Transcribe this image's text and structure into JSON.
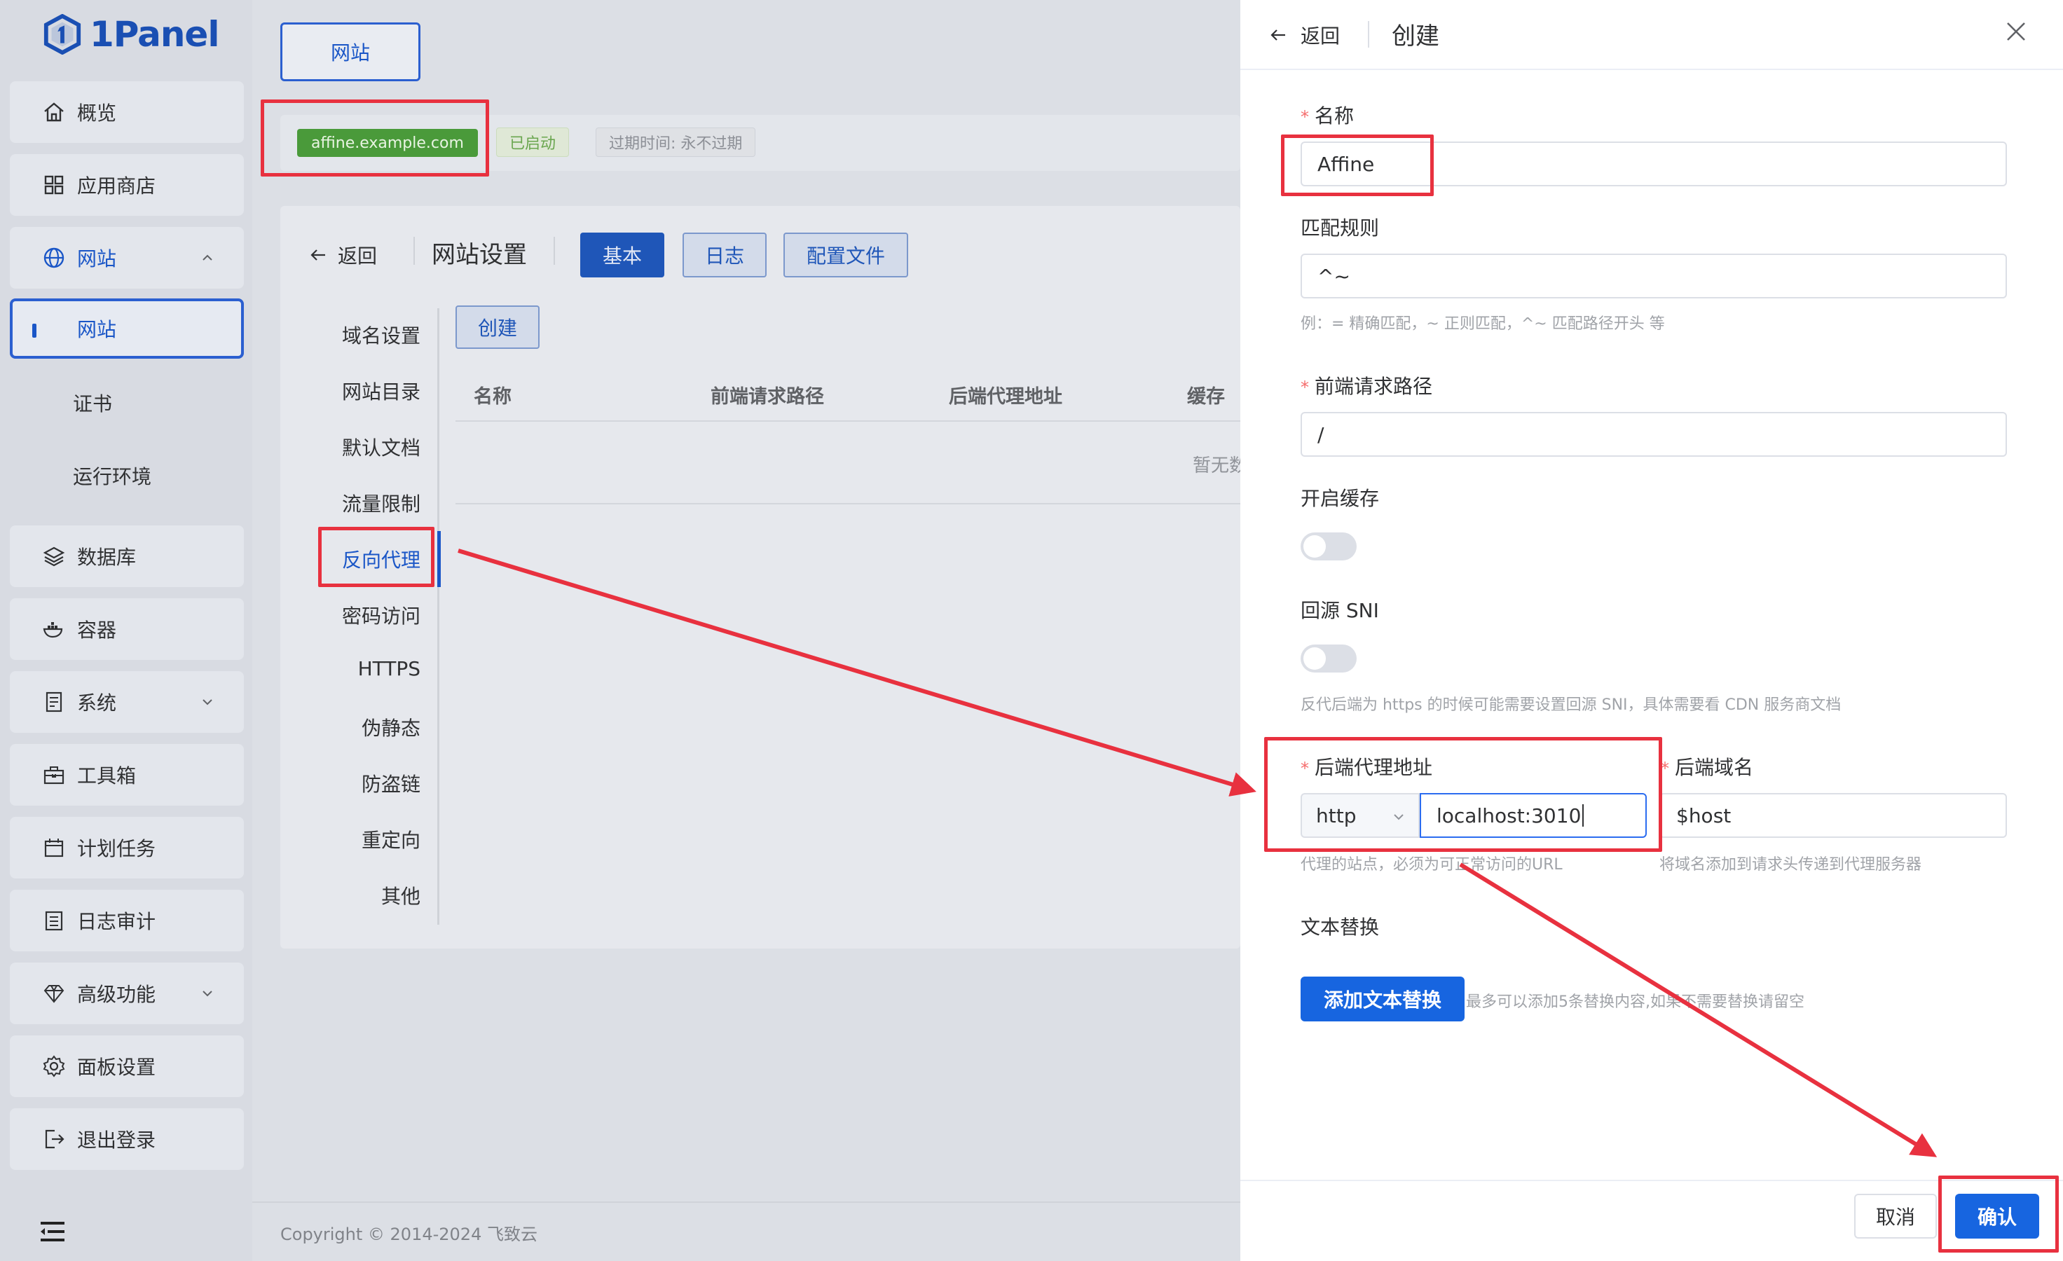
{
  "app": {
    "logo_text": "1Panel"
  },
  "sidebar": {
    "items": [
      {
        "label": "概览"
      },
      {
        "label": "应用商店"
      },
      {
        "label": "网站"
      },
      {
        "label": "网站"
      },
      {
        "label": "证书"
      },
      {
        "label": "运行环境"
      },
      {
        "label": "数据库"
      },
      {
        "label": "容器"
      },
      {
        "label": "系统"
      },
      {
        "label": "工具箱"
      },
      {
        "label": "计划任务"
      },
      {
        "label": "日志审计"
      },
      {
        "label": "高级功能"
      },
      {
        "label": "面板设置"
      },
      {
        "label": "退出登录"
      }
    ]
  },
  "main": {
    "top_tab": "网站",
    "domain": "affine.example.com",
    "status": "已启动",
    "expire": "过期时间: 永不过期",
    "back": "返回",
    "title": "网站设置",
    "tabs": [
      "基本",
      "日志",
      "配置文件"
    ],
    "menu": [
      "域名设置",
      "网站目录",
      "默认文档",
      "流量限制",
      "反向代理",
      "密码访问",
      "HTTPS",
      "伪静态",
      "防盗链",
      "重定向",
      "其他"
    ],
    "create": "创建",
    "columns": [
      "名称",
      "前端请求路径",
      "后端代理地址",
      "缓存"
    ],
    "empty": "暂无数",
    "copyright": "Copyright © 2014-2024 飞致云"
  },
  "drawer": {
    "back": "返回",
    "title": "创建",
    "name_label": "名称",
    "name_value": "Affine",
    "match_label": "匹配规则",
    "match_value": "^~",
    "match_hint": "例：= 精确匹配，~ 正则匹配，^~ 匹配路径开头 等",
    "path_label": "前端请求路径",
    "path_value": "/",
    "cache_label": "开启缓存",
    "sni_label": "回源 SNI",
    "sni_hint": "反代后端为 https 的时候可能需要设置回源 SNI，具体需要看 CDN 服务商文档",
    "proxy_label": "后端代理地址",
    "proxy_scheme": "http",
    "proxy_value": "localhost:3010",
    "proxy_hint": "代理的站点，必须为可正常访问的URL",
    "host_label": "后端域名",
    "host_value": "$host",
    "host_hint": "将域名添加到请求头传递到代理服务器",
    "replace_label": "文本替换",
    "add_replace": "添加文本替换",
    "replace_hint": "最多可以添加5条替换内容,如果不需要替换请留空",
    "cancel": "取消",
    "confirm": "确认"
  },
  "colors": {
    "accent": "#1765e0",
    "annotation": "#e8313f"
  }
}
